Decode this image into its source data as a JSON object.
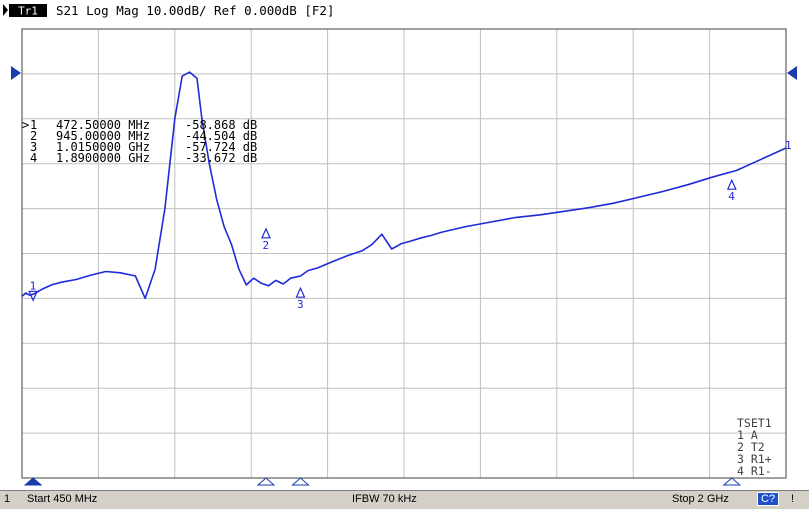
{
  "trace_header": {
    "trace_id": "Tr1",
    "text": "S21 Log Mag 10.00dB/ Ref 0.000dB [F2]"
  },
  "marker_table": [
    {
      "num": "1",
      "active": true,
      "stimulus": "472.50000 MHz",
      "value": "-58.868 dB"
    },
    {
      "num": "2",
      "active": false,
      "stimulus": "945.00000 MHz",
      "value": "-44.504 dB"
    },
    {
      "num": "3",
      "active": false,
      "stimulus": "1.0150000 GHz",
      "value": "-57.724 dB"
    },
    {
      "num": "4",
      "active": false,
      "stimulus": "1.8900000 GHz",
      "value": "-33.672 dB"
    }
  ],
  "tset": {
    "title": "TSET1",
    "lines": [
      "1 A",
      "2 T2",
      "3 R1+",
      "4 R1-"
    ]
  },
  "status": {
    "channel": "1",
    "start": "Start 450 MHz",
    "ifbw": "IFBW 70 kHz",
    "stop": "Stop 2 GHz",
    "cal": "C?",
    "flag": "!"
  },
  "colors": {
    "trace": "#1f2ad8",
    "grid": "#c0c0c0",
    "frame": "#606060",
    "marker_fill": "#1f2ad8",
    "marker_arrow": "#1a3ab0"
  },
  "chart_data": {
    "type": "line",
    "xlabel": "",
    "ylabel": "",
    "xlim": [
      450,
      2000
    ],
    "ylim": [
      -100,
      0
    ],
    "grid": true,
    "reference_level": "right-edge arrow, trace end label",
    "series": [
      {
        "x": [
          450,
          458,
          466,
          474,
          490,
          510,
          530,
          560,
          590,
          620,
          650,
          680,
          700,
          720,
          740,
          760,
          775,
          790,
          805,
          815,
          830,
          845,
          860,
          875,
          890,
          905,
          920,
          935,
          950,
          965,
          980,
          995,
          1015,
          1030,
          1050,
          1080,
          1110,
          1140,
          1160,
          1180,
          1200,
          1220,
          1240,
          1260,
          1280,
          1300,
          1350,
          1400,
          1450,
          1500,
          1550,
          1600,
          1650,
          1700,
          1750,
          1800,
          1850,
          1900,
          1950,
          2000
        ],
        "y": [
          -59.5,
          -58.8,
          -59.3,
          -59.0,
          -58.0,
          -57.0,
          -56.4,
          -55.8,
          -54.8,
          -54.0,
          -54.3,
          -55.0,
          -60.0,
          -53.5,
          -40.0,
          -20.0,
          -10.5,
          -9.6,
          -11.0,
          -20.0,
          -30.0,
          -38.0,
          -44.0,
          -48.0,
          -53.5,
          -57.0,
          -55.5,
          -56.6,
          -57.2,
          -56.0,
          -56.8,
          -55.5,
          -55.0,
          -53.8,
          -53.2,
          -51.8,
          -50.5,
          -49.4,
          -48.0,
          -45.7,
          -49.0,
          -47.8,
          -47.2,
          -46.5,
          -46.0,
          -45.3,
          -44.0,
          -43.0,
          -42.0,
          -41.4,
          -40.6,
          -39.8,
          -38.8,
          -37.5,
          -36.2,
          -34.7,
          -33.0,
          -31.5,
          -29.0,
          -26.5
        ]
      }
    ],
    "markers": [
      {
        "label": "1",
        "x": 472.5,
        "y": -58.868
      },
      {
        "label": "2",
        "x": 945,
        "y": -44.504
      },
      {
        "label": "3",
        "x": 1015,
        "y": -57.724
      },
      {
        "label": "4",
        "x": 1890,
        "y": -33.672
      }
    ]
  }
}
